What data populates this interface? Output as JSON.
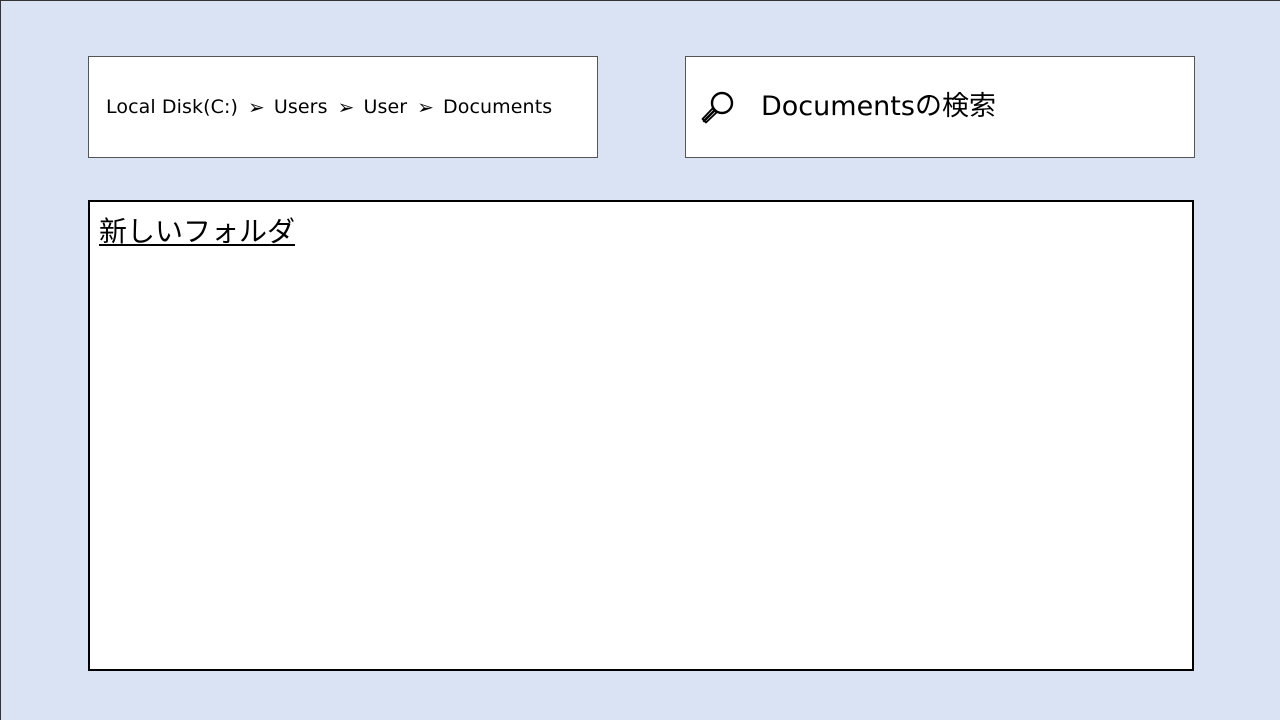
{
  "breadcrumb": {
    "items": [
      "Local Disk(C:)",
      "Users",
      "User",
      "Documents"
    ],
    "separator": "➢"
  },
  "search": {
    "icon": "magnifier-icon",
    "placeholder": "Documentsの検索"
  },
  "file_list": {
    "items": [
      {
        "name": "新しいフォルダ",
        "type": "folder"
      }
    ]
  },
  "colors": {
    "window_background": "#dae3f3",
    "panel_background": "#ffffff",
    "border": "#000000"
  }
}
